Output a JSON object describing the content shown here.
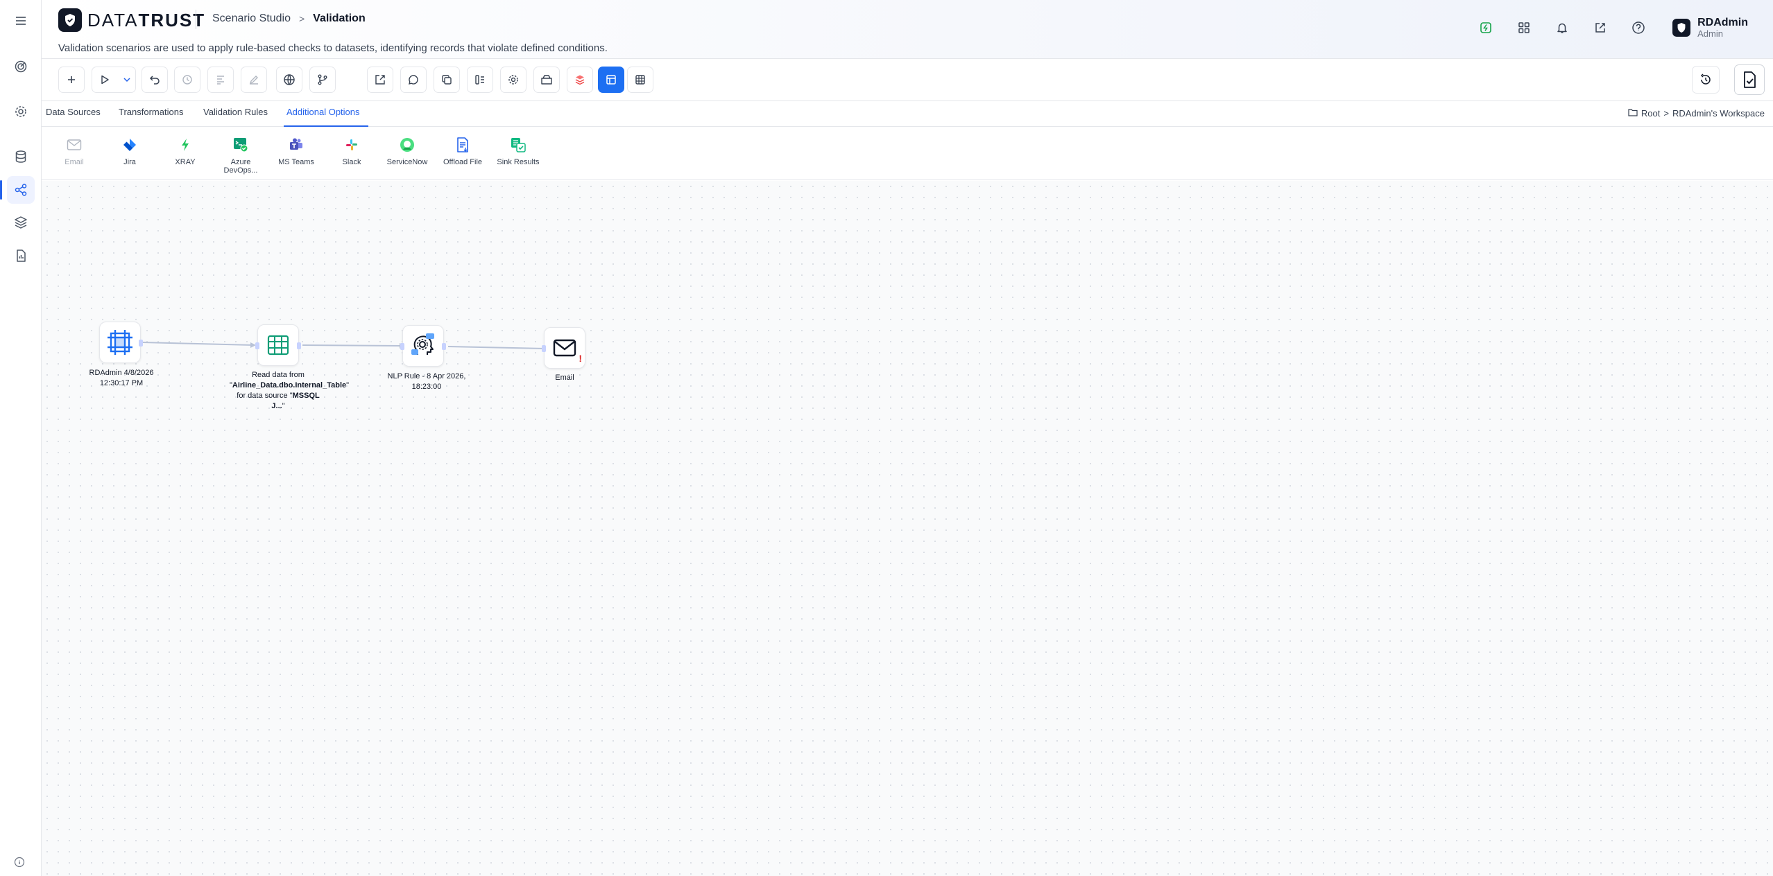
{
  "brand": {
    "name_light": "DATA",
    "name_bold": "TRUST"
  },
  "breadcrumb": {
    "parent": "Scenario Studio",
    "separator": ">",
    "current": "Validation"
  },
  "description": "Validation scenarios are used to apply rule-based checks to datasets, identifying records that violate defined conditions.",
  "user": {
    "name": "RDAdmin",
    "role": "Admin"
  },
  "header_icons": [
    "status-icon",
    "apps-grid-icon",
    "bell-icon",
    "external-link-icon",
    "help-icon"
  ],
  "sidebar": {
    "items": [
      "target-icon",
      "settings-icon",
      "database-icon",
      "flow-icon",
      "layers-icon",
      "report-icon"
    ],
    "active": "flow-icon"
  },
  "tabs": {
    "items": [
      {
        "label": "Data Sources"
      },
      {
        "label": "Transformations"
      },
      {
        "label": "Validation Rules"
      },
      {
        "label": "Additional Options"
      }
    ],
    "active": "Additional Options"
  },
  "workspace_path": {
    "root": "Root",
    "separator": ">",
    "workspace": "RDAdmin's Workspace"
  },
  "palette": {
    "items": [
      {
        "label": "Email",
        "icon": "mail-icon",
        "enabled": false
      },
      {
        "label": "Jira",
        "icon": "jira-icon",
        "enabled": true
      },
      {
        "label": "XRAY",
        "icon": "xray-icon",
        "enabled": true
      },
      {
        "label": "Azure DevOps...",
        "icon": "azure-devops-icon",
        "enabled": true
      },
      {
        "label": "MS Teams",
        "icon": "teams-icon",
        "enabled": true
      },
      {
        "label": "Slack",
        "icon": "slack-icon",
        "enabled": true
      },
      {
        "label": "ServiceNow",
        "icon": "servicenow-icon",
        "enabled": true
      },
      {
        "label": "Offload File",
        "icon": "offload-file-icon",
        "enabled": true
      },
      {
        "label": "Sink Results",
        "icon": "sink-results-icon",
        "enabled": true
      }
    ]
  },
  "flow": {
    "nodes": [
      {
        "label": "RDAdmin 4/8/2026 12:30:17 PM"
      },
      {
        "label_prefix": "Read data from \"",
        "table": "Airline_Data.dbo.Internal_Table",
        "label_mid": "\" for data source \"",
        "source": "MSSQL J...",
        "label_suffix": "\""
      },
      {
        "label": "NLP Rule - 8 Apr 2026, 18:23:00"
      },
      {
        "label": "Email"
      }
    ]
  },
  "colors": {
    "accent": "#1d6ff2",
    "warning": "#dc2626",
    "node_green": "#0f9d76"
  }
}
